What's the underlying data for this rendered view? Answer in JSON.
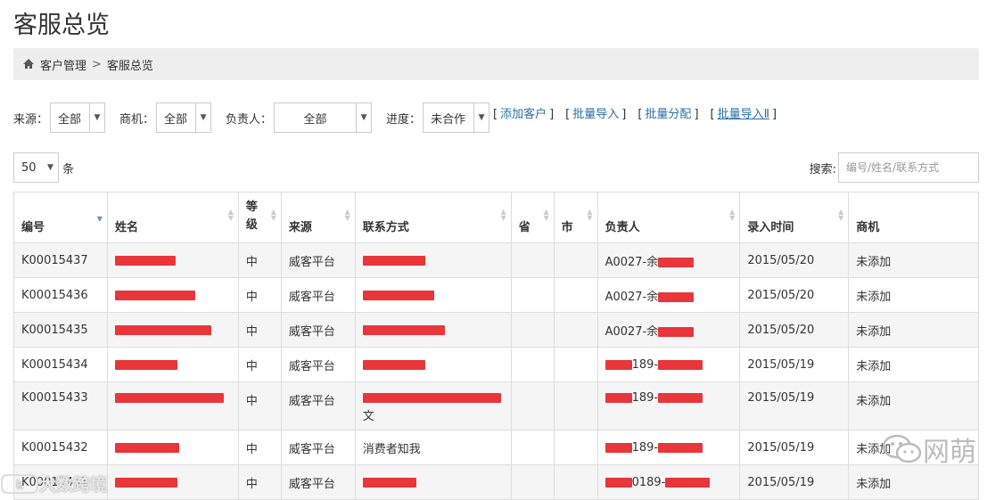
{
  "page": {
    "title": "客服总览"
  },
  "breadcrumb": {
    "items": [
      "客户管理",
      "客服总览"
    ],
    "separator": ">"
  },
  "filters": {
    "source": {
      "label": "来源：",
      "value": "全部"
    },
    "opportunity": {
      "label": "商机：",
      "value": "全部"
    },
    "owner": {
      "label": "负责人：",
      "value": "全部"
    },
    "progress": {
      "label": "进度：",
      "value": "未合作"
    }
  },
  "actions": [
    "添加客户",
    "批量导入",
    "批量分配",
    "批量导入Ⅱ"
  ],
  "paging": {
    "size": "50",
    "unit": "条"
  },
  "search": {
    "label": "搜索:",
    "placeholder": "编号/姓名/联系方式"
  },
  "table": {
    "columns": [
      "编号",
      "姓名",
      "等级",
      "来源",
      "联系方式",
      "省",
      "市",
      "负责人",
      "录入时间",
      "商机"
    ],
    "rows": [
      {
        "id": "K00015437",
        "level": "中",
        "source": "威客平台",
        "owner": "A0027-余",
        "date": "2015/05/20",
        "opp": "未添加",
        "redact": [
          68,
          70,
          0,
          40
        ]
      },
      {
        "id": "K00015436",
        "level": "中",
        "source": "威客平台",
        "owner": "A0027-余",
        "date": "2015/05/20",
        "opp": "未添加",
        "redact": [
          90,
          80,
          0,
          40
        ]
      },
      {
        "id": "K00015435",
        "level": "中",
        "source": "威客平台",
        "owner": "A0027-余",
        "date": "2015/05/20",
        "opp": "未添加",
        "redact": [
          108,
          92,
          0,
          40
        ]
      },
      {
        "id": "K00015434",
        "level": "中",
        "source": "威客平台",
        "owner": "189-",
        "date": "2015/05/19",
        "opp": "未添加",
        "redact": [
          70,
          70,
          30,
          50
        ]
      },
      {
        "id": "K00015433",
        "level": "中",
        "source": "威客平台",
        "owner": "189-",
        "date": "2015/05/19",
        "opp": "未添加",
        "redact": [
          122,
          155,
          30,
          50
        ],
        "tall": true,
        "contact_extra": "文"
      },
      {
        "id": "K00015432",
        "level": "中",
        "source": "威客平台",
        "owner": "189-",
        "date": "2015/05/19",
        "opp": "未添加",
        "redact": [
          72,
          0,
          30,
          50
        ],
        "contact_text": "消费者知我"
      },
      {
        "id": "K00015431",
        "level": "中",
        "source": "威客平台",
        "owner": "0189-",
        "date": "2015/05/19",
        "opp": "未添加",
        "redact": [
          70,
          60,
          30,
          50
        ]
      }
    ]
  },
  "watermarks": {
    "right": "网萌",
    "left": "大数跨境"
  },
  "colors": {
    "link": "#2a6fa8",
    "redaction": "#e8363a",
    "breadcrumb_bg": "#eeeeee"
  }
}
